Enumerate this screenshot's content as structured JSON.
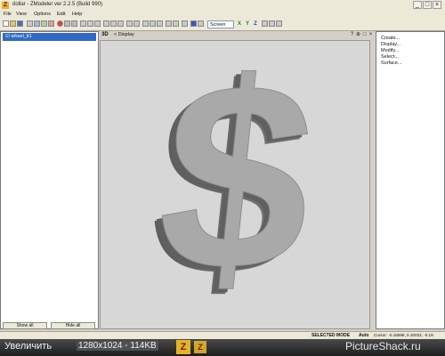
{
  "window": {
    "title": "dollar - ZModeler ver 2.2.5 (Build 990)",
    "app_icon_glyph": "Z",
    "minimize_glyph": "_",
    "maximize_glyph": "□",
    "close_glyph": "×"
  },
  "menu": [
    "File",
    "View",
    "Options",
    "Edit",
    "Help"
  ],
  "toolbar": {
    "view_select": "Screen",
    "axes": [
      {
        "label": "X",
        "color": "#2c7a2c"
      },
      {
        "label": "Y",
        "color": "#2c7a2c"
      },
      {
        "label": "Z",
        "color": "#1f3fa8"
      }
    ]
  },
  "left_panel": {
    "tree_item": "☑ wheel_lt1",
    "show_all": "Show all",
    "hide_all": "Hide all"
  },
  "viewport": {
    "mode": "3D",
    "title": "<  Display",
    "controls": [
      "?",
      "⊕",
      "□",
      "×"
    ],
    "model": "$",
    "model_color": "#a8a8a8"
  },
  "command_panel": {
    "items": [
      "Create...",
      "Display...",
      "Modify...",
      "Select...",
      "Surface..."
    ]
  },
  "status": {
    "mode": "SELECTED MODE",
    "auto": "Auto",
    "cursor": "Cursor: -0.16598, 0.10032, -0.19"
  },
  "taskbar": {
    "zoom_label": "Увеличить",
    "size_label": "1280x1024 - 114KB",
    "app_glyph": "Z",
    "watermark": "PictureShack.ru"
  }
}
